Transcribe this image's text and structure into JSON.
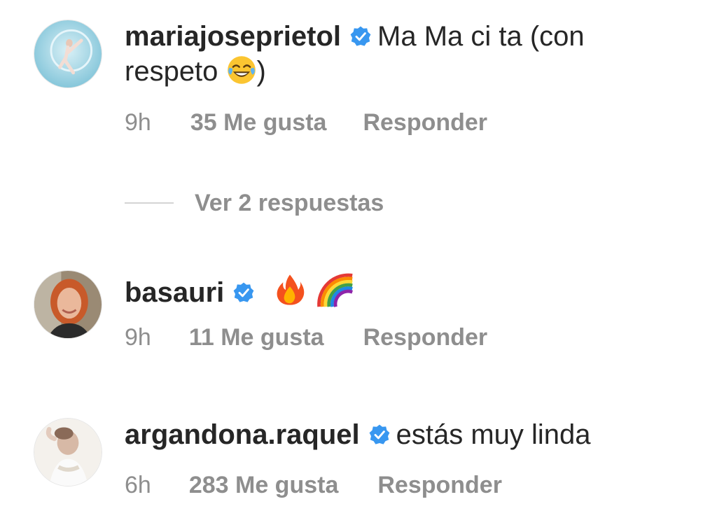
{
  "comments": [
    {
      "username": "mariajoseprietol",
      "text_line1": "Ma Ma ci ta (con",
      "text_line2_before": "respeto ",
      "text_line2_emoji": "face-with-tears-of-joy",
      "text_line2_after": ")",
      "time": "9h",
      "likes": "35 Me gusta",
      "reply": "Responder"
    },
    {
      "username": "basauri",
      "emojis": [
        "fire",
        "rainbow"
      ],
      "time": "9h",
      "likes": "11 Me gusta",
      "reply": "Responder"
    },
    {
      "username": "argandona.raquel",
      "text": "estás muy linda",
      "time": "6h",
      "likes": "283 Me gusta",
      "reply": "Responder"
    }
  ],
  "view_replies": "Ver 2 respuestas",
  "colors": {
    "verified": "#3897f0",
    "meta": "#8e8e8e",
    "text": "#262626"
  }
}
